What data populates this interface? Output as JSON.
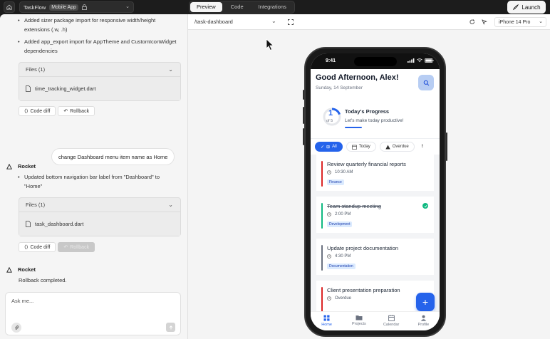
{
  "topbar": {
    "project_name": "TaskFlow",
    "project_badge": "Mobile App",
    "tabs": [
      {
        "label": "Preview",
        "active": true
      },
      {
        "label": "Code",
        "active": false
      },
      {
        "label": "Integrations",
        "active": false
      }
    ],
    "launch_label": "Launch"
  },
  "chat": {
    "bullets_top": [
      "Added sizer package import for responsive width/height extensions (.w, .h)",
      "Added app_export import for AppTheme and CustomIconWidget dependencies"
    ],
    "files1": {
      "header": "Files (1)",
      "file": "time_tracking_widget.dart"
    },
    "code_diff_label": "Code diff",
    "rollback_label": "Rollback",
    "user_message": "change Dashboard menu item name as Home",
    "assistant_name": "Rocket",
    "bullets_mid": [
      "Updated bottom navigation bar label from \"Dashboard\" to \"Home\""
    ],
    "files2": {
      "header": "Files (1)",
      "file": "task_dashboard.dart"
    },
    "code_diff_label2": "Code diff",
    "rollback_label2": "Rollback",
    "assistant_name2": "Rocket",
    "rollback_done": "Rollback completed.",
    "input_placeholder": "Ask me..."
  },
  "preview": {
    "route": "/task-dashboard",
    "device": "iPhone 14 Pro"
  },
  "app": {
    "status_time": "9:41",
    "greeting": "Good Afternoon, Alex!",
    "date": "Sunday, 14 September",
    "progress": {
      "completed": "1",
      "of_total": "of 5",
      "title": "Today's Progress",
      "subtitle": "Let's make today productive!"
    },
    "filters": [
      {
        "label": "All",
        "active": true
      },
      {
        "label": "Today",
        "active": false
      },
      {
        "label": "Overdue",
        "active": false
      }
    ],
    "tasks": [
      {
        "title": "Review quarterly financial reports",
        "time": "10:30 AM",
        "tag": "Finance",
        "color": "#dc2626",
        "done": false
      },
      {
        "title": "Team standup meeting",
        "time": "2:00 PM",
        "tag": "Development",
        "color": "#10b981",
        "done": true
      },
      {
        "title": "Update project documentation",
        "time": "4:30 PM",
        "tag": "Documentation",
        "color": "#6b7280",
        "done": false
      },
      {
        "title": "Client presentation preparation",
        "time": "Overdue",
        "tag": "",
        "color": "#dc2626",
        "done": false
      }
    ],
    "nav": [
      {
        "label": "Home",
        "icon": "home-icon",
        "active": true
      },
      {
        "label": "Projects",
        "icon": "folder-icon",
        "active": false
      },
      {
        "label": "Calendar",
        "icon": "calendar-icon",
        "active": false
      },
      {
        "label": "Profile",
        "icon": "profile-icon",
        "active": false
      }
    ],
    "accent": "#2563eb"
  }
}
